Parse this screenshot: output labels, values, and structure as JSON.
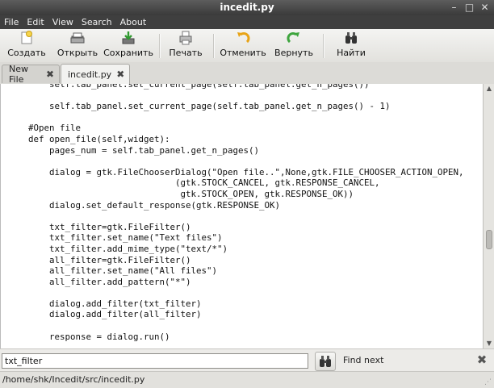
{
  "window": {
    "title": "incedit.py"
  },
  "window_controls": {
    "minimize": "–",
    "maximize": "□",
    "close": "✕"
  },
  "menu": [
    "File",
    "Edit",
    "View",
    "Search",
    "About"
  ],
  "toolbar": {
    "create": "Создать",
    "open": "Открыть",
    "save": "Сохранить",
    "print": "Печать",
    "undo": "Отменить",
    "redo": "Вернуть",
    "find": "Найти"
  },
  "tabs": [
    {
      "label": "New File",
      "close": "✖",
      "active": false
    },
    {
      "label": "incedit.py",
      "close": "✖",
      "active": true
    }
  ],
  "editor": {
    "lines": [
      "        self.tab_panel.set_current_page(self.tab_panel.get_n_pages())",
      "",
      "        self.tab_panel.set_current_page(self.tab_panel.get_n_pages() - 1)",
      "",
      "    #Open file",
      "    def open_file(self,widget):",
      "        pages_num = self.tab_panel.get_n_pages()",
      "",
      "        dialog = gtk.FileChooserDialog(\"Open file..\",None,gtk.FILE_CHOOSER_ACTION_OPEN,",
      "                                (gtk.STOCK_CANCEL, gtk.RESPONSE_CANCEL,",
      "                                 gtk.STOCK_OPEN, gtk.RESPONSE_OK))",
      "        dialog.set_default_response(gtk.RESPONSE_OK)",
      "",
      "        txt_filter=gtk.FileFilter()",
      "        txt_filter.set_name(\"Text files\")",
      "        txt_filter.add_mime_type(\"text/*\")",
      "        all_filter=gtk.FileFilter()",
      "        all_filter.set_name(\"All files\")",
      "        all_filter.add_pattern(\"*\")",
      "",
      "        dialog.add_filter(txt_filter)",
      "        dialog.add_filter(all_filter)",
      "",
      "        response = dialog.run()"
    ]
  },
  "scrollbar": {
    "up_arrow": "▲",
    "down_arrow": "▼",
    "position": 0.6
  },
  "findbar": {
    "value": "txt_filter",
    "find_next_label": "Find next",
    "close": "✖"
  },
  "statusbar": {
    "path": "/home/shk/Incedit/src/incedit.py",
    "grip": "⋰"
  },
  "colors": {
    "titlebar": "#3a3a3a",
    "menubar": "#3f3f3f",
    "editor_bg": "#ffffff",
    "code_text": "#111111"
  }
}
